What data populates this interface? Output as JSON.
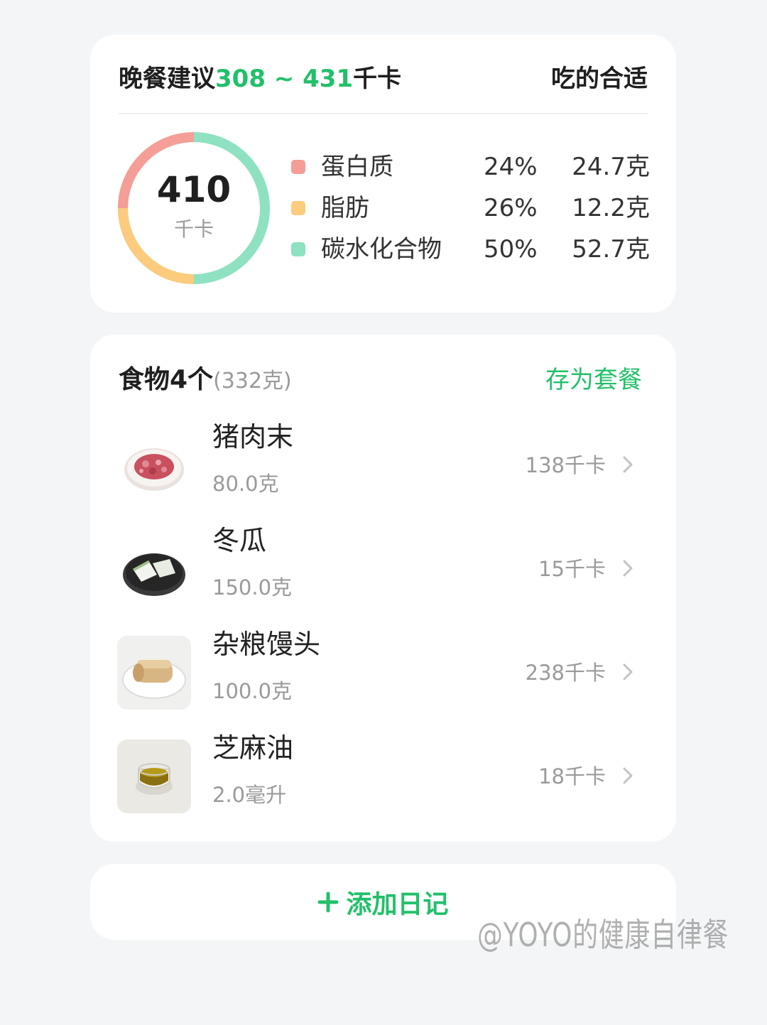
{
  "summary": {
    "title_prefix": "晚餐建议",
    "range": "308 ~ 431",
    "title_unit": "千卡",
    "status": "吃的合适",
    "calories": "410",
    "calories_unit": "千卡",
    "macros": [
      {
        "name": "蛋白质",
        "percent": "24%",
        "amount": "24.7克",
        "color": "#f59d97",
        "fraction": 0.24
      },
      {
        "name": "脂肪",
        "percent": "26%",
        "amount": "12.2克",
        "color": "#fccb7d",
        "fraction": 0.26
      },
      {
        "name": "碳水化合物",
        "percent": "50%",
        "amount": "52.7克",
        "color": "#8ee2c1",
        "fraction": 0.5
      }
    ]
  },
  "foods": {
    "title": "食物4个",
    "total_weight": "(332克)",
    "save_label": "存为套餐",
    "items": [
      {
        "name": "猪肉末",
        "amount": "80.0克",
        "kcal": "138千卡",
        "icon": "minced-pork-icon"
      },
      {
        "name": "冬瓜",
        "amount": "150.0克",
        "kcal": "15千卡",
        "icon": "winter-melon-icon"
      },
      {
        "name": "杂粮馒头",
        "amount": "100.0克",
        "kcal": "238千卡",
        "icon": "steamed-bun-icon"
      },
      {
        "name": "芝麻油",
        "amount": "2.0毫升",
        "kcal": "18千卡",
        "icon": "sesame-oil-icon"
      }
    ]
  },
  "add_button": {
    "label": "添加日记"
  },
  "watermark": "@YOYO的健康自律餐",
  "colors": {
    "accent": "#22c06a",
    "background": "#f4f5f7"
  }
}
